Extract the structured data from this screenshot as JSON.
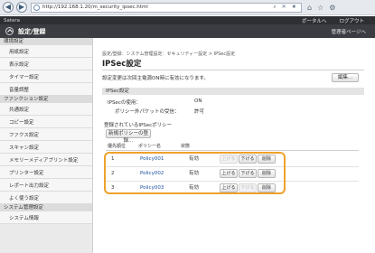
{
  "browser": {
    "back": "◀",
    "forward": "▶",
    "url": "http://192.168.1.20/m_security_ipsec.html",
    "toolbar": "⌕ ✕ ★",
    "right_icons": [
      "⌂",
      "☆",
      "⚙"
    ]
  },
  "app": {
    "brand": "Satera",
    "portal": "ポータルへ",
    "logout": "ログアウト",
    "title": "設定/登録",
    "portal_link": "管理者ページへ"
  },
  "sidebar": {
    "sections": [
      {
        "label": "環境設定",
        "items": [
          "用紙設定",
          "表示設定",
          "タイマー設定",
          "音量調整"
        ]
      },
      {
        "label": "ファンクション設定",
        "items": [
          "共通設定",
          "コピー設定",
          "ファクス設定",
          "スキャン設定",
          "メモリーメディアプリント設定",
          "プリンター設定",
          "レポート出力設定",
          "よく使う設定"
        ]
      },
      {
        "label": "システム管理設定",
        "items": [
          "システム情報"
        ]
      }
    ]
  },
  "main": {
    "breadcrumb": "設定/登録：システム管理設定：セキュリティー設定 > IPSec設定",
    "title": "IPSec設定",
    "notice": "設定変更は次回主電源ON時に有効になります。",
    "edit_label": "編集...",
    "section_title": "IPSec設定",
    "ipsec_use_label": "IPSecの使用：",
    "ipsec_use_value": "ON",
    "policy_out_label": "ポリシー外パケットの受信：",
    "policy_out_value": "許可",
    "policy_list_title": "登録されているIPSecポリシー",
    "register_label": "新規ポリシーの登録...",
    "columns": [
      "優先順位",
      "ポリシー名",
      "状態"
    ],
    "policies": [
      {
        "priority": "1",
        "name": "Policy001",
        "status": "有効",
        "up": "上げる",
        "down": "下げる",
        "delete": "削除"
      },
      {
        "priority": "2",
        "name": "Policy002",
        "status": "有効",
        "up": "上げる",
        "down": "下げる",
        "delete": "削除"
      },
      {
        "priority": "3",
        "name": "Policy003",
        "status": "有効",
        "up": "上げる",
        "down": "下げる",
        "delete": "削除"
      }
    ]
  }
}
